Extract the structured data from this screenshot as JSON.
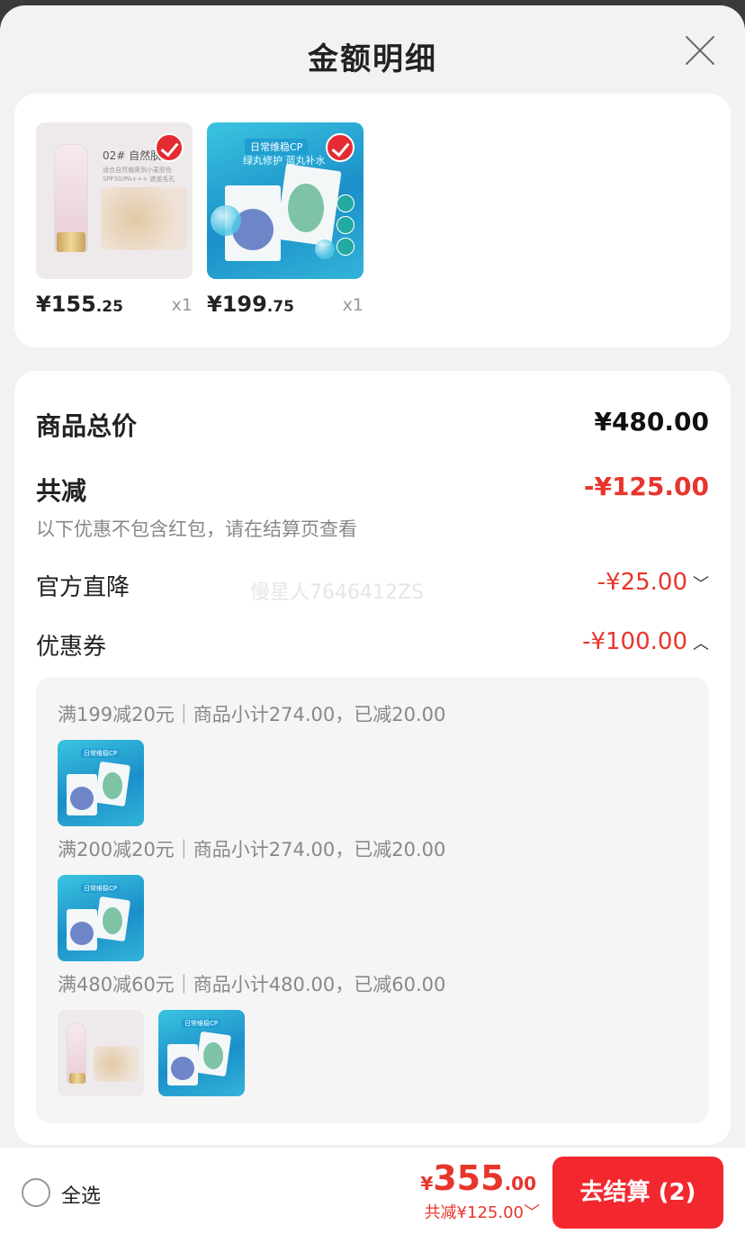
{
  "header": {
    "title": "金额明细",
    "close_icon": "close-icon"
  },
  "products": [
    {
      "name": "BB cream",
      "shade_label": "02# 自然肤",
      "fine_print": "适合自然偏黄到小麦肤色 SPF50/PA+++ 遮盖毛孔",
      "price_int": "¥155",
      "price_dec": ".25",
      "qty": "x1",
      "selected": true
    },
    {
      "name": "mask",
      "mask_title": "日常维稳CP",
      "mask_sub": "绿丸修护 蓝丸补水",
      "price_int": "¥199",
      "price_dec": ".75",
      "qty": "x1",
      "selected": true
    }
  ],
  "summary": {
    "goods_total_label": "商品总价",
    "goods_total_value": "¥480.00",
    "discount_label": "共减",
    "discount_value": "-¥125.00",
    "discount_note": "以下优惠不包含红包，请在结算页查看",
    "official_label": "官方直降",
    "official_value": "-¥25.00",
    "official_chevron": "﹀",
    "coupon_label": "优惠券",
    "coupon_value": "-¥100.00",
    "coupon_chevron": "︿"
  },
  "watermark": "慢星人7646412ZS",
  "coupons": [
    {
      "text": "满199减20元｜商品小计274.00，已减20.00"
    },
    {
      "text": "满200减20元｜商品小计274.00，已减20.00"
    },
    {
      "text": "满480减60元｜商品小计480.00，已减60.00"
    }
  ],
  "footer": {
    "select_all": "全选",
    "total_yen": "¥",
    "total_int": "355",
    "total_dec": ".00",
    "saved": "共减¥125.00",
    "saved_chevron": "﹀",
    "checkout": "去结算 (2)"
  },
  "colors": {
    "accent": "#f2282e",
    "price_red": "#e8352c",
    "check_red": "#e52b32"
  }
}
